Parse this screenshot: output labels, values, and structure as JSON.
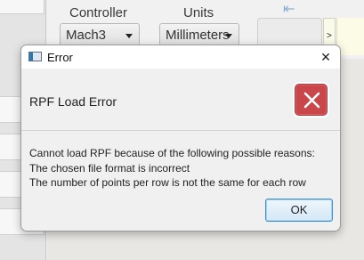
{
  "background": {
    "labels": {
      "controller": "Controller",
      "units": "Units"
    },
    "controller_combo": {
      "value": "Mach3"
    },
    "units_combo": {
      "value": "Millimeters"
    },
    "arrow_icon": "left-arrow-icon",
    "small_button_label": ">"
  },
  "dialog": {
    "title": "Error",
    "close_glyph": "✕",
    "header": "RPF Load Error",
    "icon": "error-x-icon",
    "icon_color": "#c9464a",
    "message_lines": [
      "Cannot load RPF because of the following possible reasons:",
      "The chosen file format is incorrect",
      "The number of points per row is not the same for each row"
    ],
    "ok_label": "OK",
    "accent": "#3d8fc9"
  }
}
